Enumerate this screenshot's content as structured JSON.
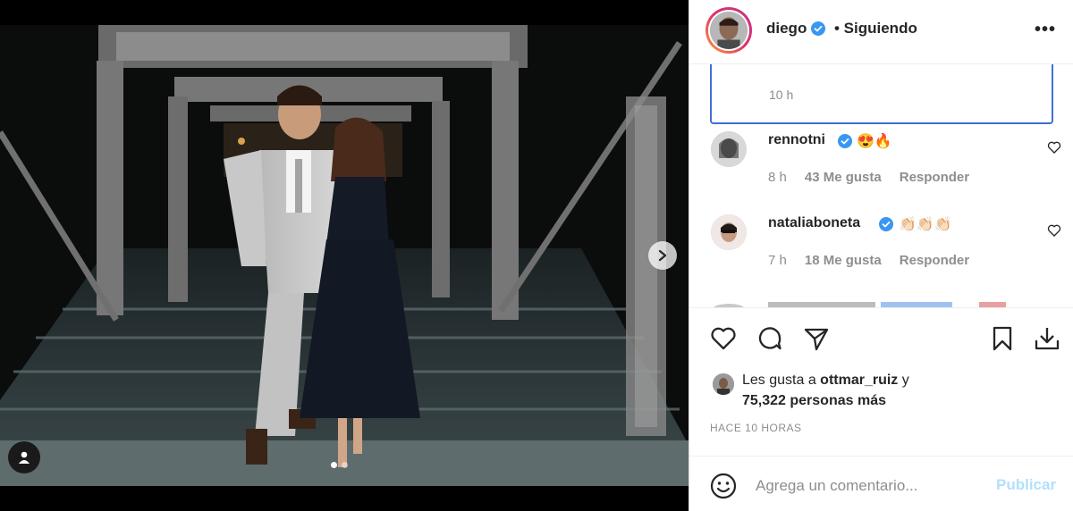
{
  "post": {
    "author": "diego",
    "verified": true,
    "follow_status": "• Siguiendo",
    "more_glyph": "•••"
  },
  "caption": {
    "time": "10 h"
  },
  "comments": [
    {
      "user": "rennotni",
      "text": "😍🔥",
      "time": "8 h",
      "likes": "43 Me gusta",
      "reply": "Responder",
      "verified": true
    },
    {
      "user": "nataliaboneta",
      "text": "👏🏻👏🏻👏🏻",
      "time": "7 h",
      "likes": "18 Me gusta",
      "reply": "Responder",
      "verified": true
    }
  ],
  "likes": {
    "prefix": "Les gusta a ",
    "liker": "ottmar_ruiz",
    "suffix": " y",
    "others": "75,322 personas más"
  },
  "timestamp": "HACE 10 HORAS",
  "composer": {
    "placeholder": "Agrega un comentario...",
    "publish_label": "Publicar"
  },
  "carousel": {
    "count": 2,
    "active": 0
  },
  "colors": {
    "verified": "#3897f0",
    "link_disabled": "#b2dffc",
    "caption_border": "#3d70d6"
  },
  "icons": [
    "chevron-right-icon",
    "user-tag-icon",
    "heart-icon",
    "comment-icon",
    "share-icon",
    "bookmark-icon",
    "download-icon",
    "emoji-icon",
    "verified-icon",
    "more-icon"
  ]
}
